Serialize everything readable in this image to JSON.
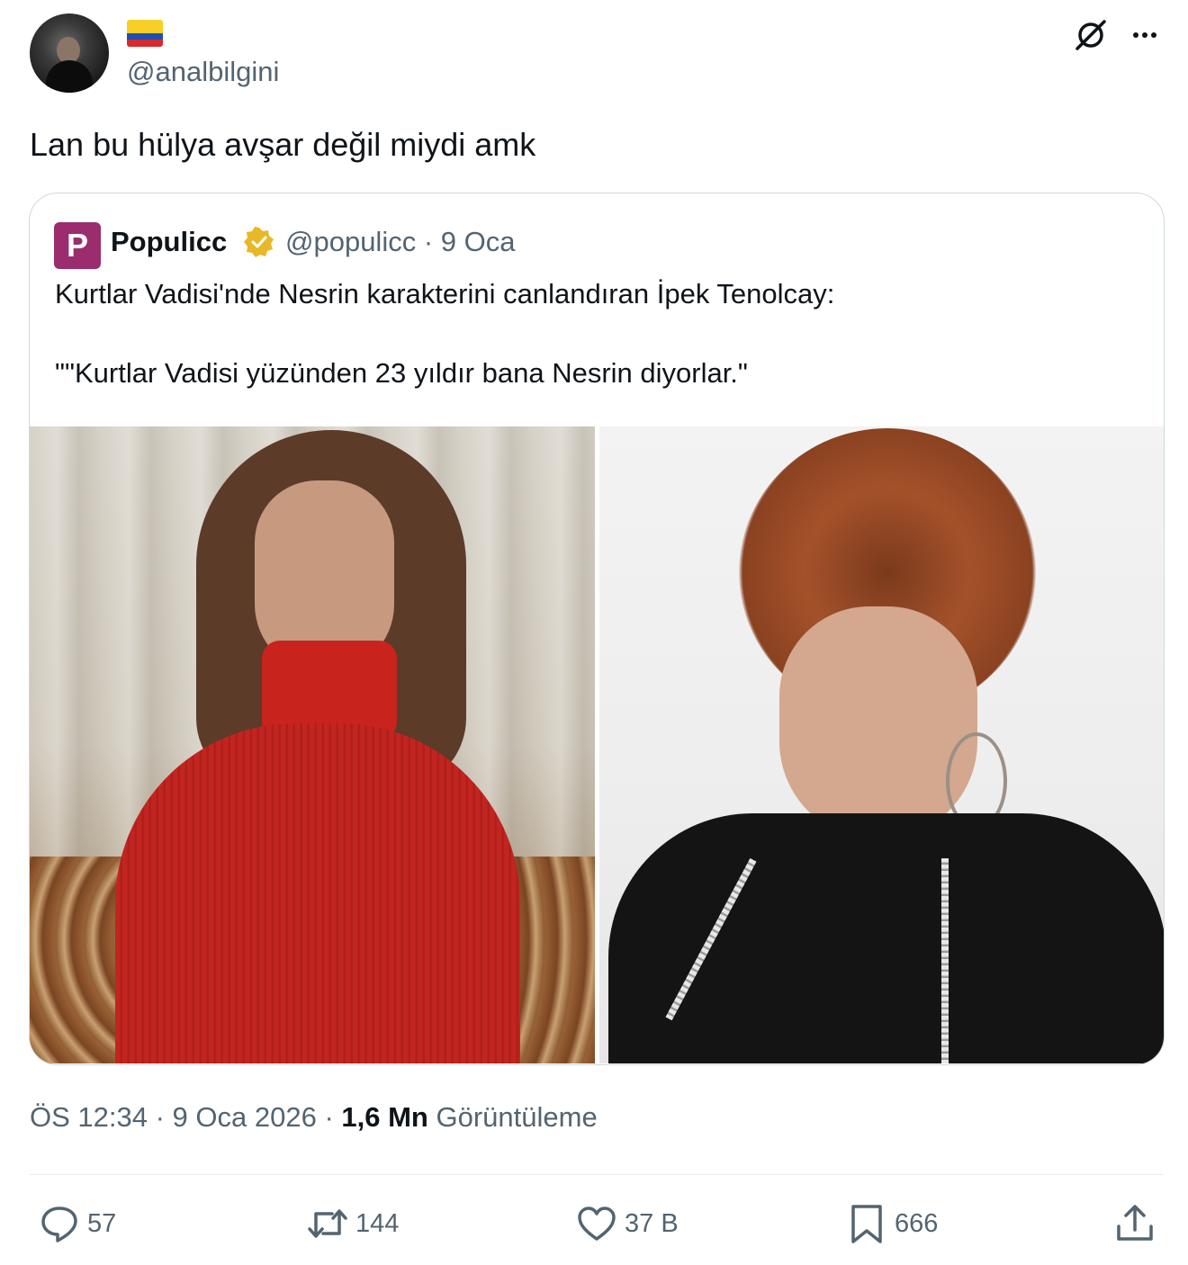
{
  "author": {
    "handle": "@analbilgini",
    "flag_icon": "colombia-flag-icon"
  },
  "tweet": {
    "text": "Lan bu hülya avşar değil miydi amk",
    "time": "ÖS 12:34",
    "date": "9 Oca 2026",
    "views_count": "1,6 Mn",
    "views_label": "Görüntüleme"
  },
  "quoted": {
    "logo_letter": "P",
    "name": "Populicc",
    "handle_date": "@populicc · 9 Oca",
    "line1": "Kurtlar Vadisi'nde Nesrin karakterini canlandıran İpek Tenolcay:",
    "line2": "\"\"Kurtlar Vadisi yüzünden 23 yıldır bana Nesrin diyorlar.\""
  },
  "actions": {
    "replies": "57",
    "retweets": "144",
    "likes": "37 B",
    "bookmarks": "666"
  },
  "colors": {
    "text": "#0f1419",
    "secondary": "#536471",
    "border": "#cfd9de",
    "logo": "#9b2d6e",
    "verified": "#e8b829"
  }
}
